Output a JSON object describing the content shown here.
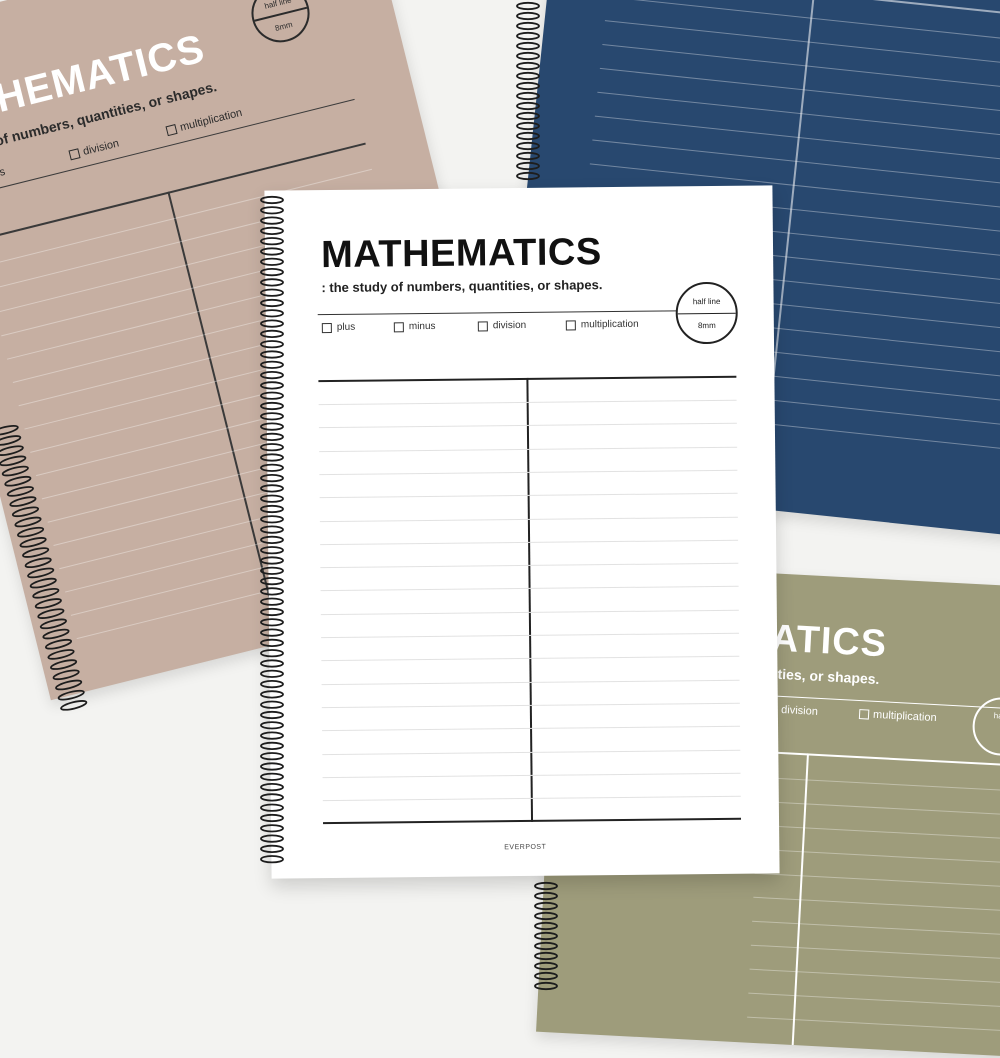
{
  "scene": {
    "background_color": "#f3f3f1",
    "notebook_colors": {
      "beige": "#c6afa2",
      "navy": "#28486f",
      "olive": "#9e9c7b",
      "white": "#ffffff"
    }
  },
  "notebook_beige": {
    "title": "ATHEMATICS",
    "subtitle": "study of numbers, quantities, or shapes.",
    "checkboxes": [
      "minus",
      "division",
      "multiplication"
    ],
    "badge_top": "half line",
    "badge_bottom": "8mm"
  },
  "notebook_olive": {
    "title": "ATICS",
    "subtitle": "tities, or shapes.",
    "checkboxes": [
      "division",
      "multiplication"
    ],
    "badge_top": "half l"
  },
  "notebook_main": {
    "title": "MATHEMATICS",
    "subtitle": ": the study of numbers, quantities, or shapes.",
    "checkboxes": [
      "plus",
      "minus",
      "division",
      "multiplication"
    ],
    "badge_top": "half line",
    "badge_bottom": "8mm",
    "brand": "EVERPOST"
  }
}
